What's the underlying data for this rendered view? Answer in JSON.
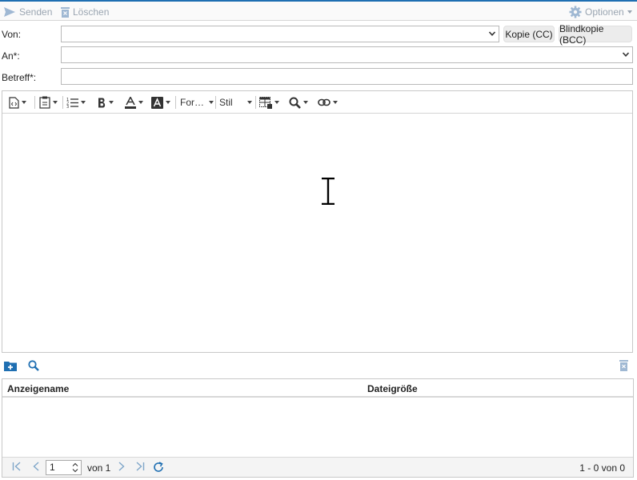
{
  "toolbar": {
    "send_label": "Senden",
    "delete_label": "Löschen",
    "options_label": "Optionen"
  },
  "form": {
    "from_label": "Von:",
    "to_label": "An*:",
    "subject_label": "Betreff*:",
    "from_value": "",
    "to_value": "",
    "subject_value": "",
    "cc_button": "Kopie (CC)",
    "bcc_button": "Blindkopie (BCC)"
  },
  "editor": {
    "format_label": "For…",
    "style_label": "Stil",
    "body_text": ""
  },
  "attachments": {
    "columns": [
      "Anzeigename",
      "Dateigröße"
    ],
    "rows": []
  },
  "pager": {
    "page_value": "1",
    "of_pages": "von 1",
    "summary": "1 - 0 von 0"
  },
  "colors": {
    "accent": "#1f6fb2",
    "disabled": "#9aa5b1"
  }
}
